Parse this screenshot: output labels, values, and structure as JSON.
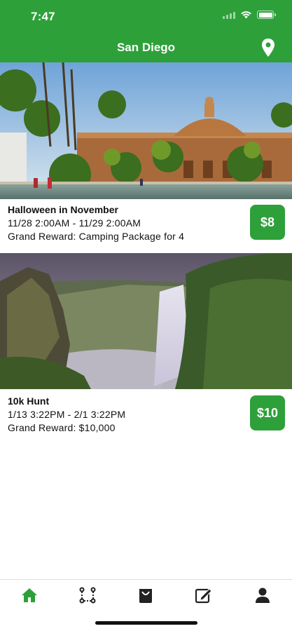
{
  "status_bar": {
    "time": "7:47"
  },
  "header": {
    "title": "San Diego",
    "location_icon": "map-pin-icon"
  },
  "hunts": [
    {
      "title": "Halloween in November",
      "dates": "11/28 2:00AM - 11/29 2:00AM",
      "reward": "Grand Reward: Camping Package for 4",
      "price": "$8",
      "image": "botanical-building-photo"
    },
    {
      "title": "10k Hunt",
      "dates": "1/13 3:22PM - 2/1 3:22PM",
      "reward": "Grand Reward: $10,000",
      "price": "$10",
      "image": "waterfall-photo"
    }
  ],
  "tabbar": {
    "items": [
      {
        "icon": "home-icon",
        "active": true
      },
      {
        "icon": "route-icon",
        "active": false
      },
      {
        "icon": "bag-icon",
        "active": false
      },
      {
        "icon": "edit-icon",
        "active": false
      },
      {
        "icon": "profile-icon",
        "active": false
      }
    ]
  },
  "colors": {
    "brand": "#2ea03a",
    "tab_active": "#2ea03a",
    "tab_inactive": "#222222"
  }
}
